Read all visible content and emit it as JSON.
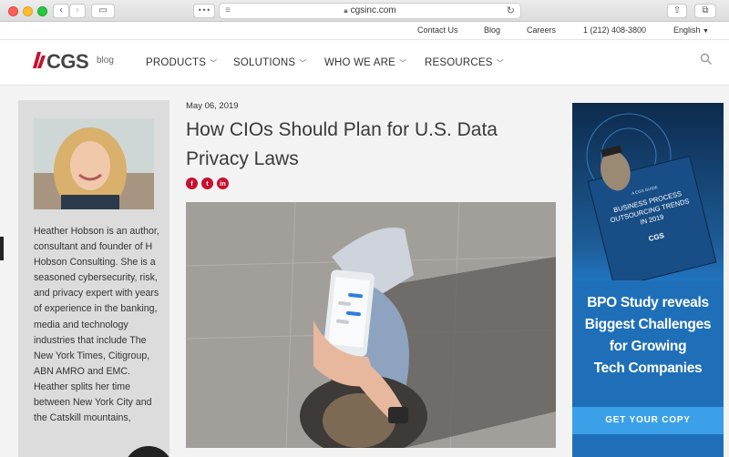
{
  "browser": {
    "url": "cgsinc.com"
  },
  "utility_nav": [
    "Contact Us",
    "Blog",
    "Careers",
    "1 (212) 408-3800",
    "English"
  ],
  "logo": {
    "brand": "CGS",
    "suffix": "blog"
  },
  "main_nav": [
    "PRODUCTS",
    "SOLUTIONS",
    "WHO WE ARE",
    "RESOURCES"
  ],
  "article": {
    "date": "May 06, 2019",
    "title": "How CIOs Should Plan for U.S. Data Privacy Laws",
    "share": [
      "f",
      "t",
      "in"
    ]
  },
  "author": {
    "bio": "Heather Hobson is an author, consultant and founder of H Hobson Consulting.  She is a seasoned cybersecurity, risk, and privacy expert with years of experience in the banking, media and technology industries that include The New York Times, Citigroup, ABN AMRO and EMC. Heather splits her time between New York City and the Catskill mountains,"
  },
  "ad": {
    "book_kicker": "A CGS GUIDE",
    "book_title": "BUSINESS PROCESS OUTSOURCING TRENDS IN 2019",
    "book_brand": "CGS",
    "headline_lines": [
      "BPO Study reveals",
      "Biggest Challenges",
      "for Growing",
      "Tech Companies"
    ],
    "cta": "GET YOUR COPY"
  },
  "colors": {
    "brand_red": "#c8102e",
    "ad_blue": "#1f6fb8",
    "cta_blue": "#3aa0e8"
  }
}
